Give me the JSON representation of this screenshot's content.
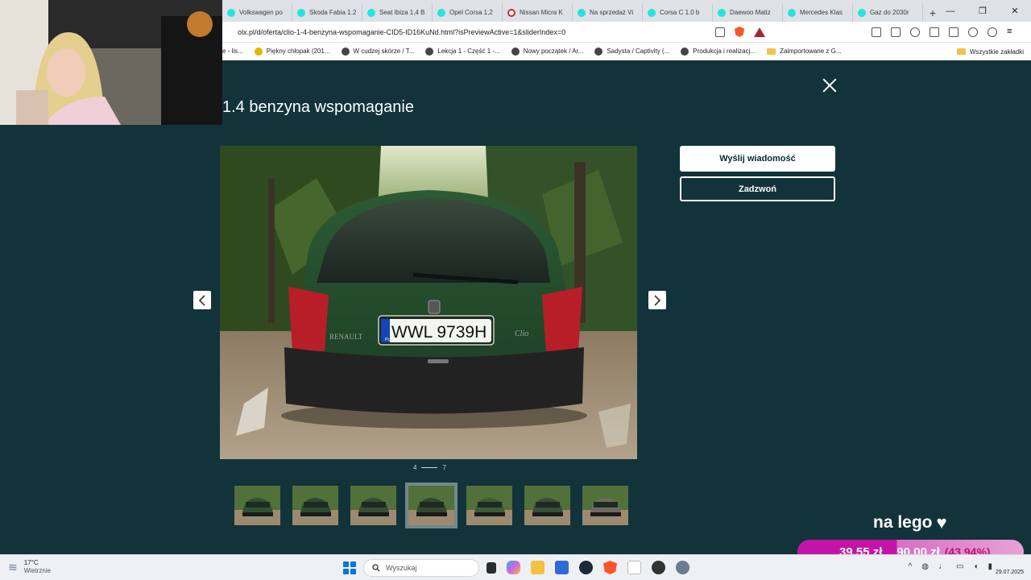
{
  "browser": {
    "tabs": [
      {
        "label": "Volkswagen po",
        "favicon": "olx-icon"
      },
      {
        "label": "Skoda Fabia 1.2",
        "favicon": "olx-icon"
      },
      {
        "label": "Seat Ibiza 1,4 B",
        "favicon": "olx-icon"
      },
      {
        "label": "Opel Corsa 1,2",
        "favicon": "olx-icon"
      },
      {
        "label": "Nissan Micra K",
        "favicon": "opera-icon"
      },
      {
        "label": "Na sprzedaż Vi",
        "favicon": "olx-icon"
      },
      {
        "label": "Corsa C 1.0 b",
        "favicon": "olx-icon"
      },
      {
        "label": "Daewoo Matiz",
        "favicon": "olx-icon"
      },
      {
        "label": "Mercedes Klas",
        "favicon": "olx-icon"
      },
      {
        "label": "Gaz do 2030r",
        "favicon": "olx-icon"
      }
    ],
    "new_tab": "+",
    "window_controls": {
      "minimize": "—",
      "maximize": "❐",
      "close": "✕"
    },
    "url": "olx.pl/d/oferta/clio-1-4-benzyna-wspomaganie-CID5-ID16KuNd.html?isPreviewActive=1&sliderIndex=0",
    "bookmarks": [
      {
        "label": "e - lis...",
        "icon": "none"
      },
      {
        "label": "Piękny chłopak (201...",
        "icon": "yellow"
      },
      {
        "label": "W cudzej skórze / T...",
        "icon": "dark"
      },
      {
        "label": "Lekcja 1 - Część 1 -...",
        "icon": "dark"
      },
      {
        "label": "Nowy początek / Ar...",
        "icon": "dark"
      },
      {
        "label": "Sadysta / Captivity (...",
        "icon": "dark"
      },
      {
        "label": "Produkcja i realizacj...",
        "icon": "dark"
      },
      {
        "label": "Zaimportowane z G...",
        "icon": "folder"
      }
    ],
    "all_bookmarks": "Wszystkie zakładki"
  },
  "gallery": {
    "title": "1.4 benzyna wspomaganie",
    "counter_current": "4",
    "counter_total": "7",
    "plate": "WWL 9739H",
    "plate_country": "PL",
    "brand_badge": "RENAULT",
    "model_badge": "Clio",
    "thumbnails": 7,
    "active_thumbnail": 4
  },
  "actions": {
    "message": "Wyślij wiadomość",
    "call": "Zadzwoń"
  },
  "overlay": {
    "tagline": "na lego",
    "heart": "♥",
    "goal_current": "39,55 zł",
    "goal_target": "90,00 zł",
    "goal_percent": "(43.94%)",
    "goal_fraction": 0.4394
  },
  "taskbar": {
    "temperature": "17°C",
    "weather_desc": "Wietrznie",
    "search_placeholder": "Wyszukaj",
    "date": "29.07.2025"
  }
}
